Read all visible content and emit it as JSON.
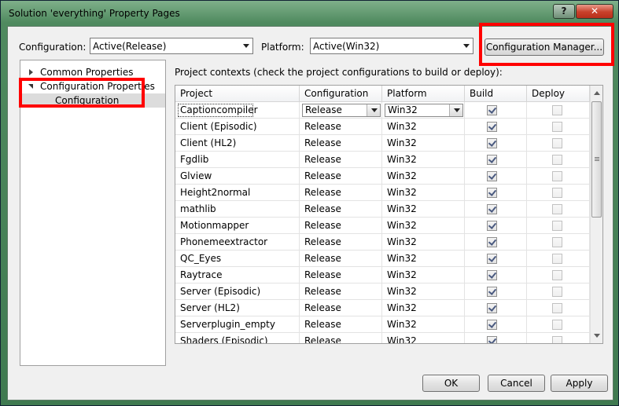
{
  "window": {
    "title": "Solution 'everything' Property Pages",
    "help_label": "?",
    "close_label": "✕"
  },
  "toolbar": {
    "configuration_label": "Configuration:",
    "configuration_value": "Active(Release)",
    "platform_label": "Platform:",
    "platform_value": "Active(Win32)",
    "config_manager_label": "Configuration Manager..."
  },
  "tree": {
    "items": [
      {
        "label": "Common Properties"
      },
      {
        "label": "Configuration Properties"
      },
      {
        "label": "Configuration"
      }
    ]
  },
  "grid": {
    "caption": "Project contexts (check the project configurations to build or deploy):",
    "columns": [
      "Project",
      "Configuration",
      "Platform",
      "Build",
      "Deploy"
    ],
    "rows": [
      {
        "project": "Captioncompiler",
        "configuration": "Release",
        "platform": "Win32",
        "build": true,
        "deploy": false
      },
      {
        "project": "Client (Episodic)",
        "configuration": "Release",
        "platform": "Win32",
        "build": true,
        "deploy": false
      },
      {
        "project": "Client (HL2)",
        "configuration": "Release",
        "platform": "Win32",
        "build": true,
        "deploy": false
      },
      {
        "project": "Fgdlib",
        "configuration": "Release",
        "platform": "Win32",
        "build": true,
        "deploy": false
      },
      {
        "project": "Glview",
        "configuration": "Release",
        "platform": "Win32",
        "build": true,
        "deploy": false
      },
      {
        "project": "Height2normal",
        "configuration": "Release",
        "platform": "Win32",
        "build": true,
        "deploy": false
      },
      {
        "project": "mathlib",
        "configuration": "Release",
        "platform": "Win32",
        "build": true,
        "deploy": false
      },
      {
        "project": "Motionmapper",
        "configuration": "Release",
        "platform": "Win32",
        "build": true,
        "deploy": false
      },
      {
        "project": "Phonemeextractor",
        "configuration": "Release",
        "platform": "Win32",
        "build": true,
        "deploy": false
      },
      {
        "project": "QC_Eyes",
        "configuration": "Release",
        "platform": "Win32",
        "build": true,
        "deploy": false
      },
      {
        "project": "Raytrace",
        "configuration": "Release",
        "platform": "Win32",
        "build": true,
        "deploy": false
      },
      {
        "project": "Server (Episodic)",
        "configuration": "Release",
        "platform": "Win32",
        "build": true,
        "deploy": false
      },
      {
        "project": "Server (HL2)",
        "configuration": "Release",
        "platform": "Win32",
        "build": true,
        "deploy": false
      },
      {
        "project": "Serverplugin_empty",
        "configuration": "Release",
        "platform": "Win32",
        "build": true,
        "deploy": false
      },
      {
        "project": "Shaders (Episodic)",
        "configuration": "Release",
        "platform": "Win32",
        "build": true,
        "deploy": false
      }
    ]
  },
  "buttons": {
    "ok": "OK",
    "cancel": "Cancel",
    "apply": "Apply"
  },
  "colors": {
    "highlight": "#ff0000",
    "selection": "#dcdcdc"
  }
}
